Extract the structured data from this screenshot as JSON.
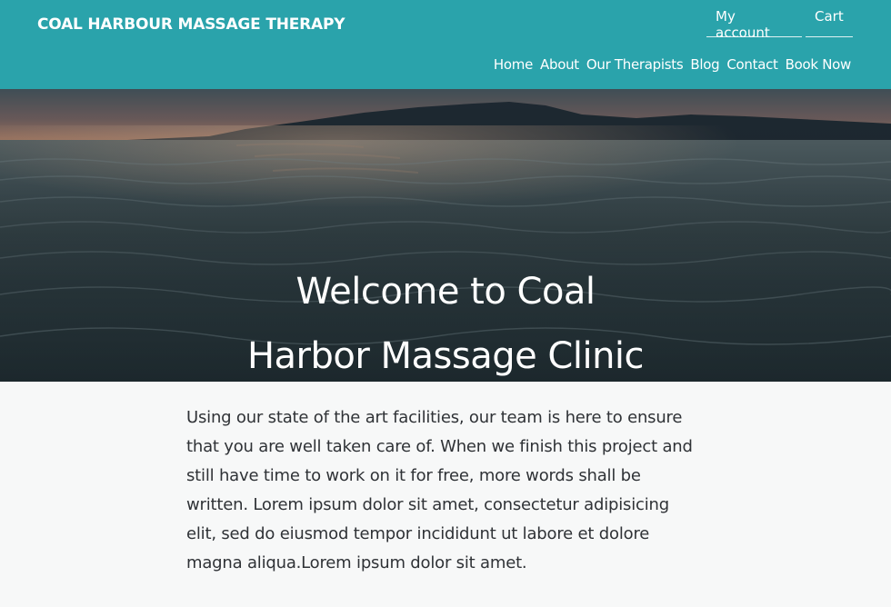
{
  "header": {
    "brand": "COAL HARBOUR MASSAGE THERAPY",
    "account_links": [
      "My account",
      "Cart"
    ],
    "nav": [
      "Home",
      "About",
      "Our Therapists",
      "Blog",
      "Contact",
      "Book Now"
    ]
  },
  "hero": {
    "title_line1": "Welcome to Coal",
    "title_line2": "Harbor Massage Clinic",
    "image": "sunset-over-ocean-water"
  },
  "content": {
    "intro": "Using our state of the art facilities, our team is here to ensure that you are well taken care of. When we finish this project and still have time to work on it for free, more words shall be written. Lorem ipsum dolor sit amet, consectetur adipisicing elit, sed do eiusmod tempor incididunt ut labore et dolore magna aliqua.Lorem ipsum dolor sit amet."
  },
  "colors": {
    "header_bg": "#2aa3ab",
    "page_bg": "#f7f8f8",
    "text": "#2f3236"
  }
}
